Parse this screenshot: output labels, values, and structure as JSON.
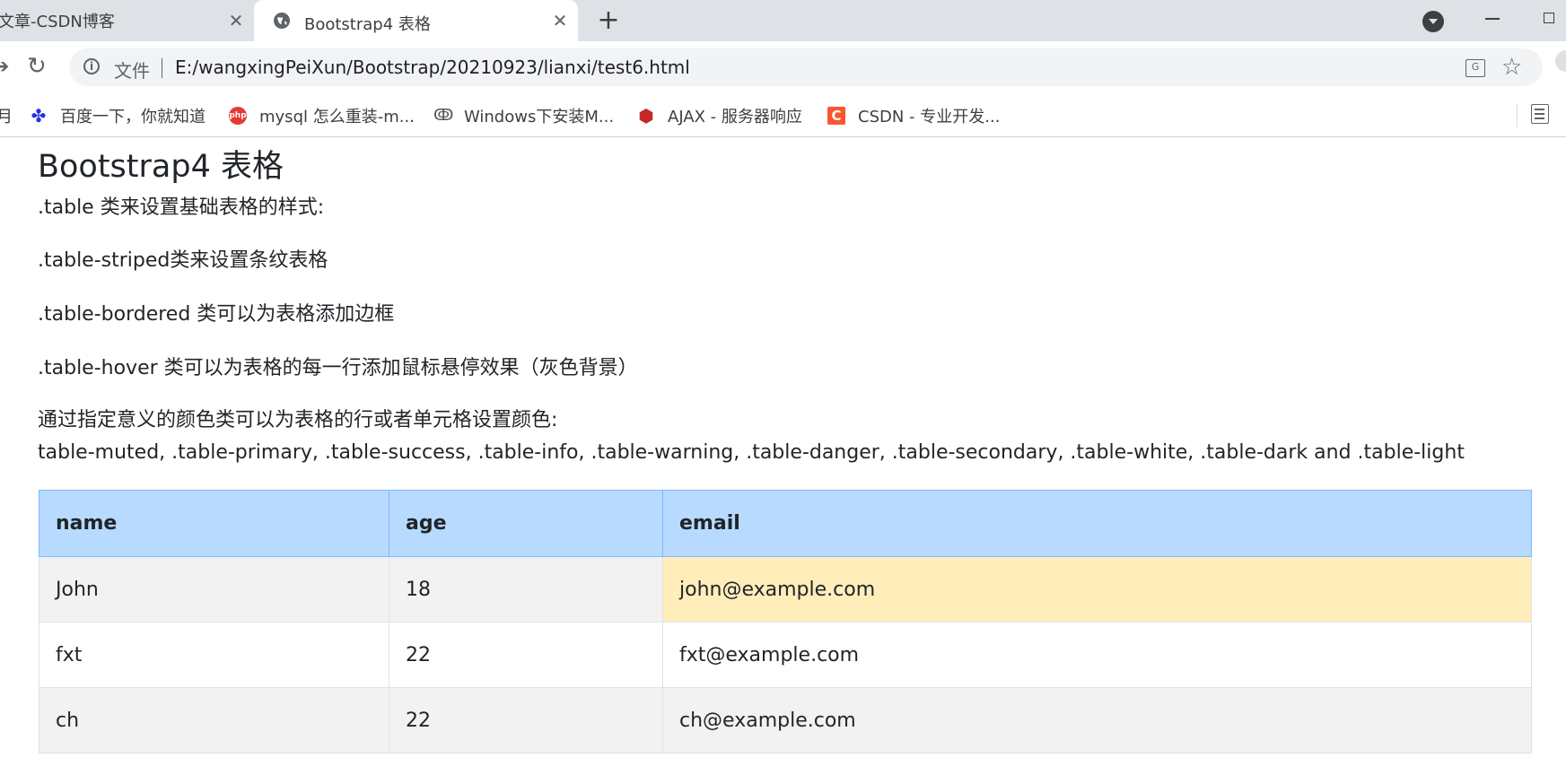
{
  "browser": {
    "prev_tab": {
      "title": "文章-CSDN博客",
      "close": "✕"
    },
    "active_tab": {
      "title": "Bootstrap4 表格",
      "close": "✕"
    },
    "new_tab": "+",
    "address": {
      "scheme_label": "文件",
      "url": "E:/wangxingPeiXun/Bootstrap/20210923/lianxi/test6.html"
    },
    "bookmarks": [
      {
        "label": "月",
        "icon": "folder-icon"
      },
      {
        "label": "百度一下，你就知道",
        "icon": "baidu-icon"
      },
      {
        "label": "mysql 怎么重装-m...",
        "icon": "php-icon"
      },
      {
        "label": "Windows下安装M...",
        "icon": "windows-icon"
      },
      {
        "label": "AJAX - 服务器响应",
        "icon": "ajax-icon"
      },
      {
        "label": "CSDN - 专业开发...",
        "icon": "csdn-icon"
      }
    ]
  },
  "page": {
    "heading": "Bootstrap4 表格",
    "paragraphs": [
      ".table 类来设置基础表格的样式:",
      ".table-striped类来设置条纹表格",
      ".table-bordered 类可以为表格添加边框",
      ".table-hover 类可以为表格的每一行添加鼠标悬停效果（灰色背景）",
      "通过指定意义的颜色类可以为表格的行或者单元格设置颜色:",
      "table-muted, .table-primary, .table-success, .table-info, .table-warning, .table-danger, .table-secondary, .table-white, .table-dark and .table-light"
    ],
    "table": {
      "headers": [
        "name",
        "age",
        "email"
      ],
      "rows": [
        [
          "John",
          "18",
          "john@example.com"
        ],
        [
          "fxt",
          "22",
          "fxt@example.com"
        ],
        [
          "ch",
          "22",
          "ch@example.com"
        ]
      ]
    }
  },
  "colors": {
    "header_row": "#b8daff",
    "warning_cell": "#ffeeba",
    "striped_row": "#f2f2f2",
    "tabstrip": "#dee1e6",
    "csdn_brand": "#fc5531"
  }
}
